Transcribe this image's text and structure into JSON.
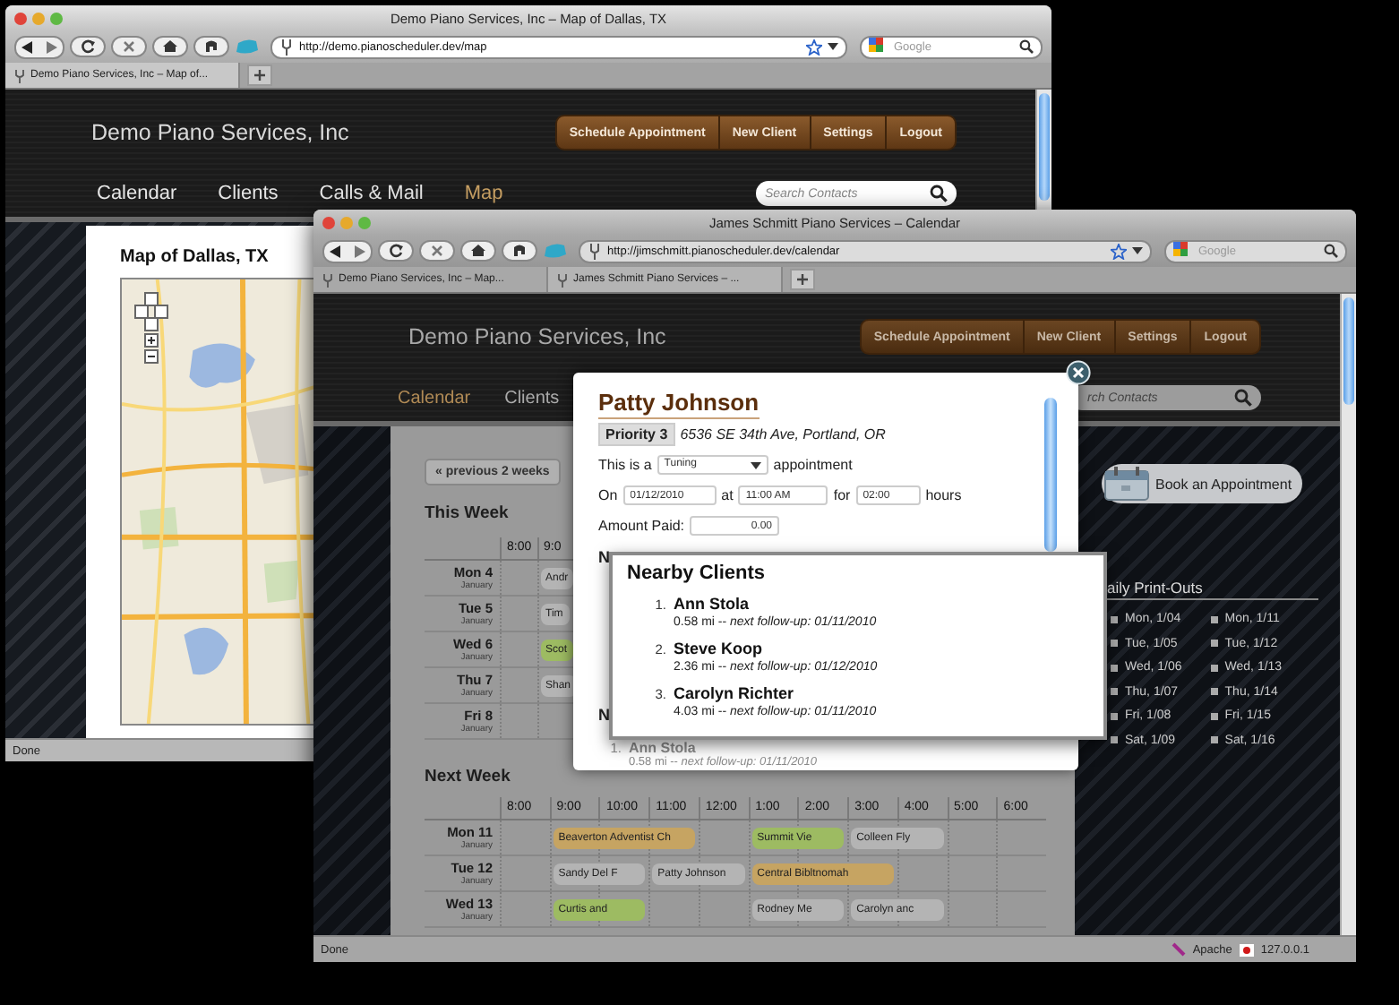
{
  "windows": [
    {
      "kind": "map",
      "title": "Demo Piano Services, Inc – Map of Dallas, TX",
      "url": "http://demo.pianoscheduler.dev/map",
      "web_search": {
        "placeholder": "Google"
      },
      "tabs": [
        {
          "label": "Demo Piano Services, Inc – Map of...",
          "selected": true
        }
      ],
      "site_title": "Demo Piano Services, Inc",
      "header_buttons": [
        "Schedule Appointment",
        "New Client",
        "Settings",
        "Logout"
      ],
      "nav": [
        {
          "label": "Calendar",
          "selected": false
        },
        {
          "label": "Clients",
          "selected": false
        },
        {
          "label": "Calls & Mail",
          "selected": false
        },
        {
          "label": "Map",
          "selected": true
        }
      ],
      "contact_search": {
        "placeholder": "Search Contacts"
      },
      "map_title": "Map of Dallas, TX",
      "map": {
        "kind": "picture"
      },
      "status": {
        "text": "Done"
      }
    },
    {
      "kind": "calendar",
      "title": "James Schmitt Piano Services – Calendar",
      "url": "http://jimschmitt.pianoscheduler.dev/calendar",
      "web_search": {
        "placeholder": "Google"
      },
      "tabs": [
        {
          "label": "Demo Piano Services, Inc – Map...",
          "selected": false
        },
        {
          "label": "James Schmitt Piano Services – ...",
          "selected": true
        }
      ],
      "site_title": "Demo Piano Services, Inc",
      "header_buttons": [
        "Schedule Appointment",
        "New Client",
        "Settings",
        "Logout"
      ],
      "nav": [
        {
          "label": "Calendar",
          "selected": true
        },
        {
          "label": "Clients",
          "selected": false
        }
      ],
      "contact_search": {
        "placeholder": "rch Contacts"
      },
      "prev_button": "« previous 2 weeks",
      "weeks": [
        {
          "title": "This Week",
          "times": [
            "8:00",
            "9:0"
          ],
          "rows": [
            {
              "day": "Mon 4",
              "month": "January",
              "cells": [
                {
                  "kind": "empty"
                },
                {
                  "kind": "appointment",
                  "label": "Andr",
                  "color": "#b4b4b4"
                }
              ]
            },
            {
              "day": "Tue 5",
              "month": "January",
              "cells": [
                {
                  "kind": "empty"
                },
                {
                  "kind": "appointment",
                  "label": "Tim",
                  "color": "#b4b4b4"
                }
              ]
            },
            {
              "day": "Wed 6",
              "month": "January",
              "cells": [
                {
                  "kind": "empty"
                },
                {
                  "kind": "appointment",
                  "label": "Scot",
                  "color": "#9dbb62"
                }
              ]
            },
            {
              "day": "Thu 7",
              "month": "January",
              "cells": [
                {
                  "kind": "empty"
                },
                {
                  "kind": "appointment",
                  "label": "Shan",
                  "color": "#b4b4b4"
                }
              ]
            },
            {
              "day": "Fri 8",
              "month": "January",
              "cells": [
                {
                  "kind": "empty"
                },
                {
                  "kind": "empty"
                }
              ]
            }
          ]
        },
        {
          "title": "Next Week",
          "times": [
            "8:00",
            "9:00",
            "10:00",
            "11:00",
            "12:00",
            "1:00",
            "2:00",
            "3:00",
            "4:00",
            "5:00",
            "6:00"
          ],
          "rows": [
            {
              "day": "Mon 11",
              "month": "January",
              "cells": [
                {
                  "kind": "empty"
                },
                {
                  "kind": "appointment",
                  "label": "Beaverton Adventist Ch",
                  "color": "#c6a462"
                },
                {
                  "kind": "covered"
                },
                {
                  "kind": "covered"
                },
                {
                  "kind": "empty"
                },
                {
                  "kind": "appointment",
                  "label": "Summit Vie",
                  "color": "#9dbb62"
                },
                {
                  "kind": "covered"
                },
                {
                  "kind": "appointment",
                  "label": "Colleen Fly",
                  "color": "#b4b4b4"
                },
                {
                  "kind": "covered"
                },
                {
                  "kind": "empty"
                },
                {
                  "kind": "empty"
                }
              ]
            },
            {
              "day": "Tue 12",
              "month": "January",
              "cells": [
                {
                  "kind": "empty"
                },
                {
                  "kind": "appointment",
                  "label": "Sandy Del F",
                  "color": "#b4b4b4"
                },
                {
                  "kind": "covered"
                },
                {
                  "kind": "appointment",
                  "label": "Patty Johnson",
                  "color": "#b4b4b4"
                },
                {
                  "kind": "covered"
                },
                {
                  "kind": "appointment",
                  "label": "Central Bibltnomah",
                  "color": "#c6a462"
                },
                {
                  "kind": "covered"
                },
                {
                  "kind": "covered"
                },
                {
                  "kind": "empty"
                },
                {
                  "kind": "empty"
                },
                {
                  "kind": "empty"
                }
              ]
            },
            {
              "day": "Wed 13",
              "month": "January",
              "cells": [
                {
                  "kind": "empty"
                },
                {
                  "kind": "appointment",
                  "label": "Curtis and",
                  "color": "#9dbb62"
                },
                {
                  "kind": "covered"
                },
                {
                  "kind": "empty"
                },
                {
                  "kind": "empty"
                },
                {
                  "kind": "appointment",
                  "label": "Rodney Me",
                  "color": "#b4b4b4"
                },
                {
                  "kind": "covered"
                },
                {
                  "kind": "appointment",
                  "label": "Carolyn anc",
                  "color": "#b4b4b4"
                },
                {
                  "kind": "covered"
                },
                {
                  "kind": "empty"
                },
                {
                  "kind": "empty"
                }
              ]
            }
          ]
        }
      ],
      "sidebar": {
        "book_button": "Book an Appointment",
        "printouts_title": "aily Print-Outs",
        "printout_columns": [
          {
            "dates": [
              "Mon, 1/04",
              "Tue, 1/05",
              "Wed, 1/06",
              "Thu, 1/07",
              "Fri, 1/08",
              "Sat, 1/09"
            ]
          },
          {
            "dates": [
              "Mon, 1/11",
              "Tue, 1/12",
              "Wed, 1/13",
              "Thu, 1/14",
              "Fri, 1/15",
              "Sat, 1/16"
            ]
          }
        ]
      },
      "modal": {
        "client_name": "Patty Johnson",
        "priority": "Priority 3",
        "address": "6536 SE 34th Ave, Portland, OR",
        "type_prefix": "This is a",
        "type": "Tuning",
        "type_suffix": "appointment",
        "date_label": "On",
        "date": "01/12/2010",
        "time_label": "at",
        "time": "11:00 AM",
        "duration_label": "for",
        "duration": "02:00",
        "duration_unit": "hours",
        "paid_label": "Amount Paid:",
        "paid": "0.00",
        "notes_label": "N",
        "nearby_label": "N",
        "nearby_first": {
          "number": "1.",
          "name": "Ann Stola",
          "detail": "0.58 mi -- *next follow-up: 01/11/2010*"
        }
      },
      "nearby_popup": {
        "title": "Nearby Clients",
        "clients": [
          {
            "number": "1.",
            "name": "Ann Stola",
            "detail": "0.58 mi -- *next follow-up: 01/11/2010*"
          },
          {
            "number": "2.",
            "name": "Steve Koop",
            "detail": "2.36 mi -- *next follow-up: 01/12/2010*"
          },
          {
            "number": "3.",
            "name": "Carolyn Richter",
            "detail": "4.03 mi -- *next follow-up: 01/11/2010*"
          }
        ]
      },
      "status": {
        "text": "Done",
        "items": [
          {
            "kind": "server",
            "label": "Apache"
          },
          {
            "kind": "address",
            "label": "127.0.0.1"
          }
        ]
      }
    }
  ]
}
